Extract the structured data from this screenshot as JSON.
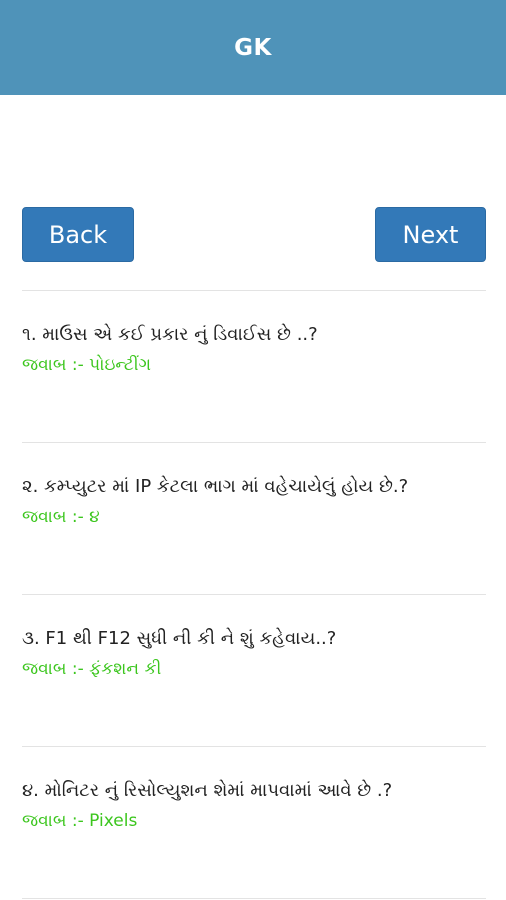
{
  "app_bar": {
    "title": "GK"
  },
  "nav": {
    "back_label": "Back",
    "next_label": "Next"
  },
  "questions": [
    {
      "question": "૧. માઉસ એ કઈ પ્રકાર નું ડિવાઈસ છે ..?",
      "answer": "જવાબ :- પોઇન્ટીંગ"
    },
    {
      "question": "૨. કમ્પ્યુટર માં IP કેટલા ભાગ માં વહેચાયેલું હોય છે.?",
      "answer": "જવાબ :- ૪"
    },
    {
      "question": "૩. F1 થી F12 સુધી ની કી ને શું કહેવાય..?",
      "answer": "જવાબ :- ફંકશન કી"
    },
    {
      "question": "૪. મોનિટર નું રિસોલ્યુશન શેમાં માપવામાં આવે છે .?",
      "answer": "જવાબ :- Pixels"
    }
  ],
  "colors": {
    "app_bar": "#4f93b9",
    "button": "#3379b8",
    "answer": "#3cc61e",
    "divider": "#e3e3e3"
  }
}
